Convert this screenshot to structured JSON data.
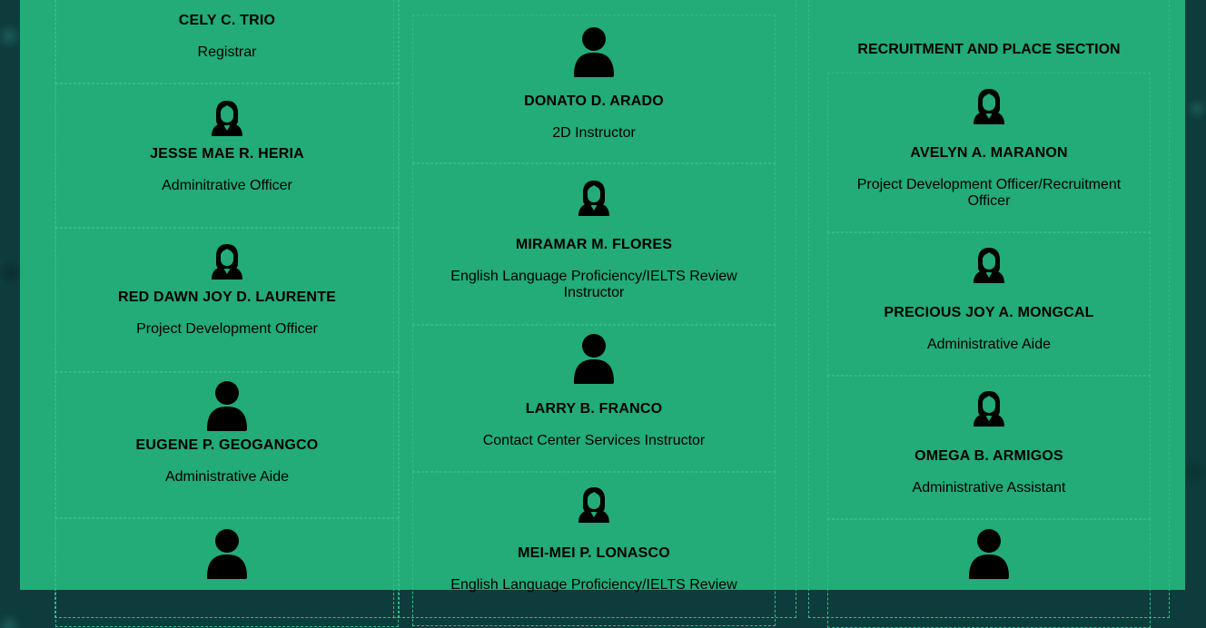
{
  "colors": {
    "panel": "#23ab78",
    "background": "#0e3c3c",
    "text": "#000000"
  },
  "column1": {
    "cards": [
      {
        "name": "CELY C. TRIO",
        "role": "Registrar",
        "icon": "female-user-icon"
      },
      {
        "name": "JESSE MAE R. HERIA",
        "role": "Adminitrative Officer",
        "icon": "female-user-icon"
      },
      {
        "name": "RED DAWN JOY D. LAURENTE",
        "role": "Project Development Officer",
        "icon": "female-user-icon"
      },
      {
        "name": "EUGENE P. GEOGANGCO",
        "role": "Administrative Aide",
        "icon": "male-user-icon"
      },
      {
        "icon": "male-user-icon"
      }
    ]
  },
  "column2": {
    "cards": [
      {
        "name": "DONATO D. ARADO",
        "role": "2D Instructor",
        "icon": "male-user-icon"
      },
      {
        "name": "MIRAMAR M. FLORES",
        "role": "English Language Proficiency/IELTS Review Instructor",
        "icon": "female-user-icon"
      },
      {
        "name": "LARRY B. FRANCO",
        "role": "Contact Center Services Instructor",
        "icon": "male-user-icon"
      },
      {
        "name": "MEI-MEI P. LONASCO",
        "role": "English Language Proficiency/IELTS Review",
        "icon": "female-user-icon"
      }
    ]
  },
  "column3": {
    "section_title": "RECRUITMENT AND PLACE SECTION",
    "cards": [
      {
        "name": "AVELYN A. MARANON",
        "role": "Project Development Officer/Recruitment Officer",
        "icon": "female-user-icon"
      },
      {
        "name": "PRECIOUS JOY A. MONGCAL",
        "role": "Administrative Aide",
        "icon": "female-user-icon"
      },
      {
        "name": "OMEGA B. ARMIGOS",
        "role": "Administrative Assistant",
        "icon": "female-user-icon"
      },
      {
        "icon": "male-user-icon"
      }
    ]
  }
}
